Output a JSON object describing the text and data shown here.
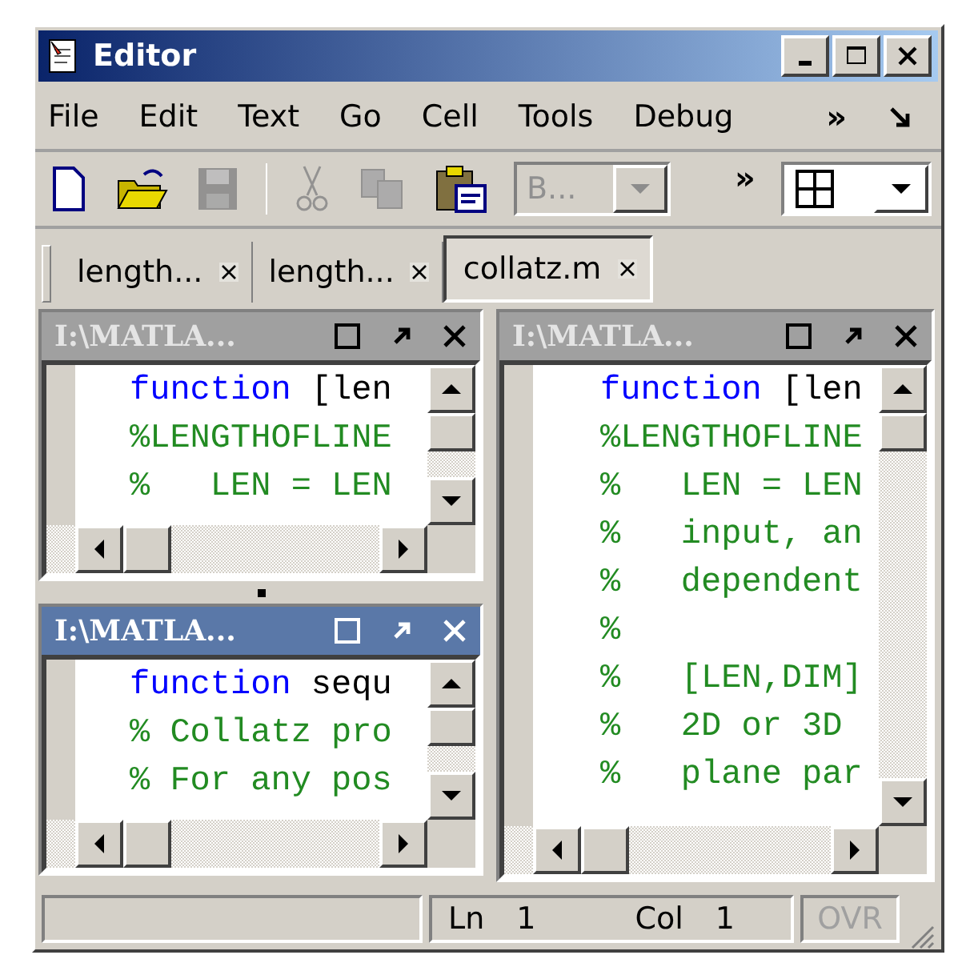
{
  "window": {
    "title": "Editor"
  },
  "menu": {
    "items": [
      "File",
      "Edit",
      "Text",
      "Go",
      "Cell",
      "Tools",
      "Debug"
    ],
    "overflow": "»"
  },
  "toolbar": {
    "buttons": [
      {
        "kind": "new",
        "disabled": false
      },
      {
        "kind": "open",
        "disabled": false
      },
      {
        "kind": "save",
        "disabled": true
      },
      {
        "kind": "separator"
      },
      {
        "kind": "cut",
        "disabled": true
      },
      {
        "kind": "copy",
        "disabled": true
      },
      {
        "kind": "paste",
        "disabled": false
      }
    ],
    "combo": {
      "value": "B...",
      "disabled": true
    },
    "overflow": "»"
  },
  "tabs": [
    {
      "label": "length...",
      "selected": false
    },
    {
      "label": "length...",
      "selected": false
    },
    {
      "label": "collatz.m",
      "selected": true
    }
  ],
  "panels": [
    {
      "title": "I:\\MATLA...",
      "active": false,
      "lines": [
        {
          "kind": "function",
          "keyword": "function",
          "rest": "[len"
        },
        {
          "kind": "comment",
          "text": "%LENGTHOFLINE"
        },
        {
          "kind": "comment",
          "text": "%   LEN = LEN"
        }
      ]
    },
    {
      "title": "I:\\MATLA...",
      "active": true,
      "lines": [
        {
          "kind": "function",
          "keyword": "function",
          "rest": "sequ"
        },
        {
          "kind": "comment",
          "text": "% Collatz pro"
        },
        {
          "kind": "comment",
          "text": "% For any pos"
        }
      ]
    },
    {
      "title": "I:\\MATLA...",
      "active": false,
      "lines": [
        {
          "kind": "function",
          "keyword": "function",
          "rest": "[len"
        },
        {
          "kind": "comment",
          "text": "%LENGTHOFLINE"
        },
        {
          "kind": "comment",
          "text": "%   LEN = LEN"
        },
        {
          "kind": "comment",
          "text": "%   input, an"
        },
        {
          "kind": "comment",
          "text": "%   dependent"
        },
        {
          "kind": "comment",
          "text": "%"
        },
        {
          "kind": "comment",
          "text": "%   [LEN,DIM]"
        },
        {
          "kind": "comment",
          "text": "%   2D or 3D"
        },
        {
          "kind": "comment",
          "text": "%   plane par"
        }
      ]
    }
  ],
  "status_bar": {
    "ln_label": "Ln",
    "ln": "1",
    "col_label": "Col",
    "col": "1",
    "ovr": {
      "text": "OVR",
      "disabled": true
    }
  }
}
